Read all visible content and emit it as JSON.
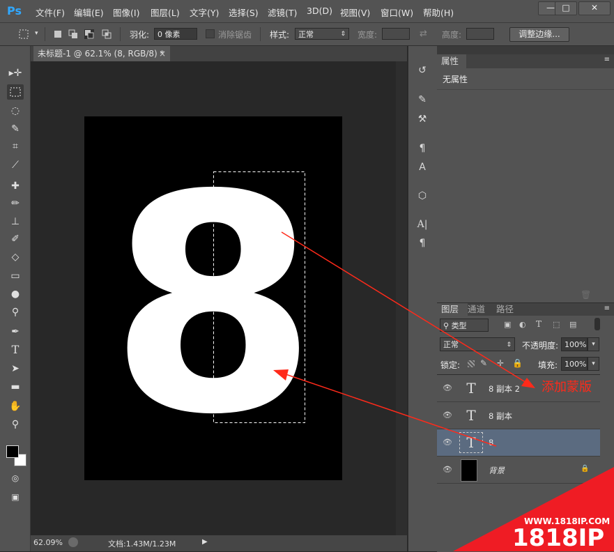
{
  "app": {
    "logo": "Ps"
  },
  "menu": [
    "文件(F)",
    "编辑(E)",
    "图像(I)",
    "图层(L)",
    "文字(Y)",
    "选择(S)",
    "滤镜(T)",
    "3D(D)",
    "视图(V)",
    "窗口(W)",
    "帮助(H)"
  ],
  "window_controls": {
    "minimize": "—",
    "maximize": "□",
    "close": "✕"
  },
  "options": {
    "feather_label": "羽化:",
    "feather_value": "0 像素",
    "antialias_label": "消除锯齿",
    "style_label": "样式:",
    "style_value": "正常",
    "width_label": "宽度:",
    "height_label": "高度:",
    "refine_button": "调整边缘..."
  },
  "document": {
    "tab_title": "未标题-1 @ 62.1% (8, RGB/8) *",
    "close": "×",
    "canvas_glyph": "8",
    "canvas_color": "#000000",
    "glyph_color": "#ffffff"
  },
  "status": {
    "zoom": "62.09%",
    "doc_info": "文档:1.43M/1.23M"
  },
  "properties": {
    "tab": "属性",
    "content": "无属性"
  },
  "layers_panel": {
    "tabs": [
      "图层",
      "通道",
      "路径"
    ],
    "filter_kind": "类型",
    "blend_mode": "正常",
    "opacity_label": "不透明度:",
    "opacity_value": "100%",
    "lock_label": "锁定:",
    "fill_label": "填充:",
    "fill_value": "100%",
    "layers": [
      {
        "name": "8 副本 2",
        "type": "text",
        "selected": false
      },
      {
        "name": "8 副本",
        "type": "text",
        "selected": false
      },
      {
        "name": "8",
        "type": "text",
        "selected": true
      },
      {
        "name": "背景",
        "type": "background",
        "selected": false,
        "locked": true
      }
    ]
  },
  "annotation": {
    "text": "添加蒙版",
    "color": "#ff2a1a"
  },
  "watermark": {
    "url": "WWW.1818IP.COM",
    "brand": "1818IP",
    "color": "#ef1c24"
  },
  "colors": {
    "accent": "#31a8ff",
    "selected_layer": "#5b6b80",
    "panel": "#535353",
    "arrow": "#ff2a1a"
  }
}
